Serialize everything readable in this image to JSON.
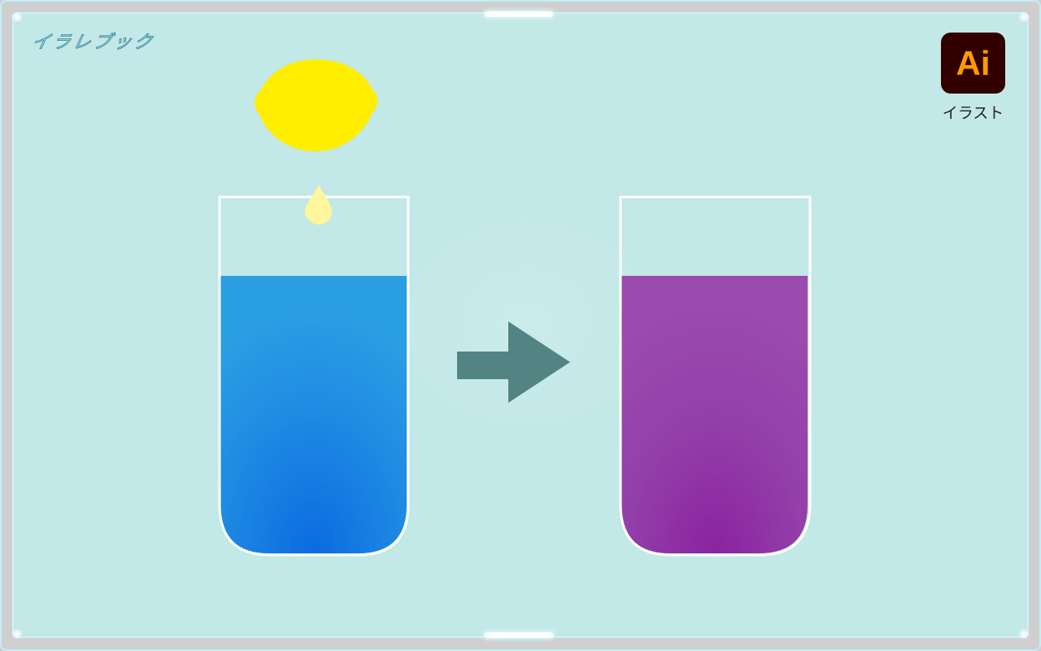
{
  "brand": {
    "logo_text": "イラレブック"
  },
  "app_badge": {
    "icon_text": "Ai",
    "label": "イラスト",
    "bg_color": "#330000",
    "fg_color": "#ff9a00"
  },
  "illustration": {
    "lemon_color": "#ffee00",
    "drop_color": "#fff59d",
    "arrow_color": "#518482",
    "background_color": "#c2e8e7",
    "glass_before": {
      "liquid_color_top": "#2b9fe3",
      "liquid_color_bottom": "#0b6be0",
      "fill_level": 0.78
    },
    "glass_after": {
      "liquid_color_top": "#9a4bad",
      "liquid_color_bottom": "#8a23a0",
      "fill_level": 0.78
    }
  }
}
